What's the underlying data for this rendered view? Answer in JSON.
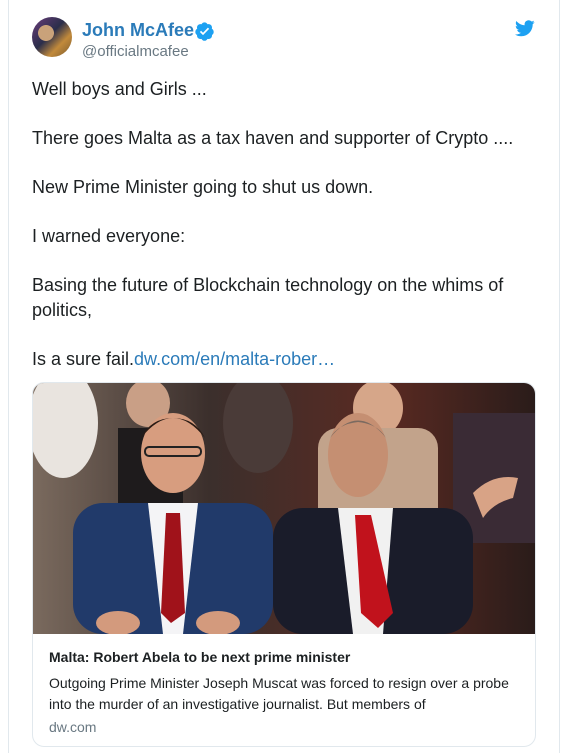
{
  "author": {
    "display_name": "John McAfee",
    "handle": "@officialmcafee",
    "avatar_icon": "profile-avatar",
    "verified_icon": "verified-badge-icon"
  },
  "platform_icon": "twitter-bird-icon",
  "tweet": {
    "lines": [
      "Well boys and Girls ...",
      "There goes Malta as a tax haven and supporter of Crypto ....",
      "New Prime Minister going to shut us down.",
      "I warned everyone:",
      "Basing the future of Blockchain technology on the whims of politics,"
    ],
    "last_line_prefix": "Is a sure fail.",
    "link_text": "dw.com/en/malta-rober…"
  },
  "card": {
    "title": "Malta: Robert Abela to be next prime minister",
    "description": "Outgoing Prime Minister Joseph Muscat was forced to resign over a probe into the murder of an investigative journalist. But members of",
    "domain": "dw.com"
  },
  "colors": {
    "link": "#2b7bb9",
    "twitter_blue": "#1da1f2",
    "text": "#1c2022",
    "muted": "#697882",
    "border": "#e1e8ed"
  }
}
